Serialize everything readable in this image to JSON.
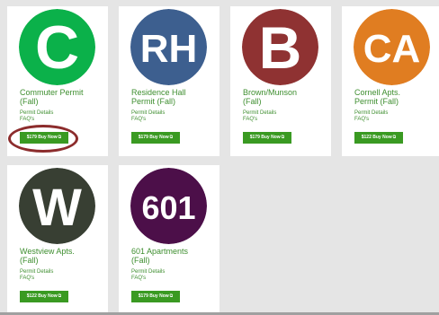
{
  "permits": [
    {
      "logo_text": "C",
      "logo_color": "#0bb14a",
      "title_line1": "Commuter Permit",
      "title_line2": "(Fall)",
      "details_link": "Permit Details",
      "faq_link": "FAQ's",
      "price": "$179",
      "buy_label": "Buy Now",
      "buy_icon": "external-link-icon"
    },
    {
      "logo_text": "RH",
      "logo_color": "#3d5f8f",
      "title_line1": "Residence Hall",
      "title_line2": "Permit (Fall)",
      "details_link": "Permit Details",
      "faq_link": "FAQ's",
      "price": "$179",
      "buy_label": "Buy Now",
      "buy_icon": "external-link-icon"
    },
    {
      "logo_text": "B",
      "logo_color": "#8f3232",
      "title_line1": "Brown/Munson",
      "title_line2": "(Fall)",
      "details_link": "Permit Details",
      "faq_link": "FAQ's",
      "price": "$179",
      "buy_label": "Buy Now",
      "buy_icon": "external-link-icon"
    },
    {
      "logo_text": "CA",
      "logo_color": "#e07d21",
      "title_line1": "Cornell Apts.",
      "title_line2": "Permit (Fall)",
      "details_link": "Permit Details",
      "faq_link": "FAQ's",
      "price": "$122",
      "buy_label": "Buy Now",
      "buy_icon": "external-link-icon"
    },
    {
      "logo_text": "W",
      "logo_color": "#383f33",
      "title_line1": "Westview Apts.",
      "title_line2": "(Fall)",
      "details_link": "Permit Details",
      "faq_link": "FAQ's",
      "price": "$122",
      "buy_label": "Buy Now",
      "buy_icon": "external-link-icon"
    },
    {
      "logo_text": "601",
      "logo_color": "#4c0f49",
      "title_line1": "601 Apartments",
      "title_line2": "(Fall)",
      "details_link": "Permit Details",
      "faq_link": "FAQ's",
      "price": "$179",
      "buy_label": "Buy Now",
      "buy_icon": "external-link-icon"
    }
  ],
  "colors": {
    "accent_green": "#3e8e2f",
    "button_green": "#3a9a22",
    "highlight_ring": "#8c2c2c",
    "page_background": "#e5e5e5"
  }
}
